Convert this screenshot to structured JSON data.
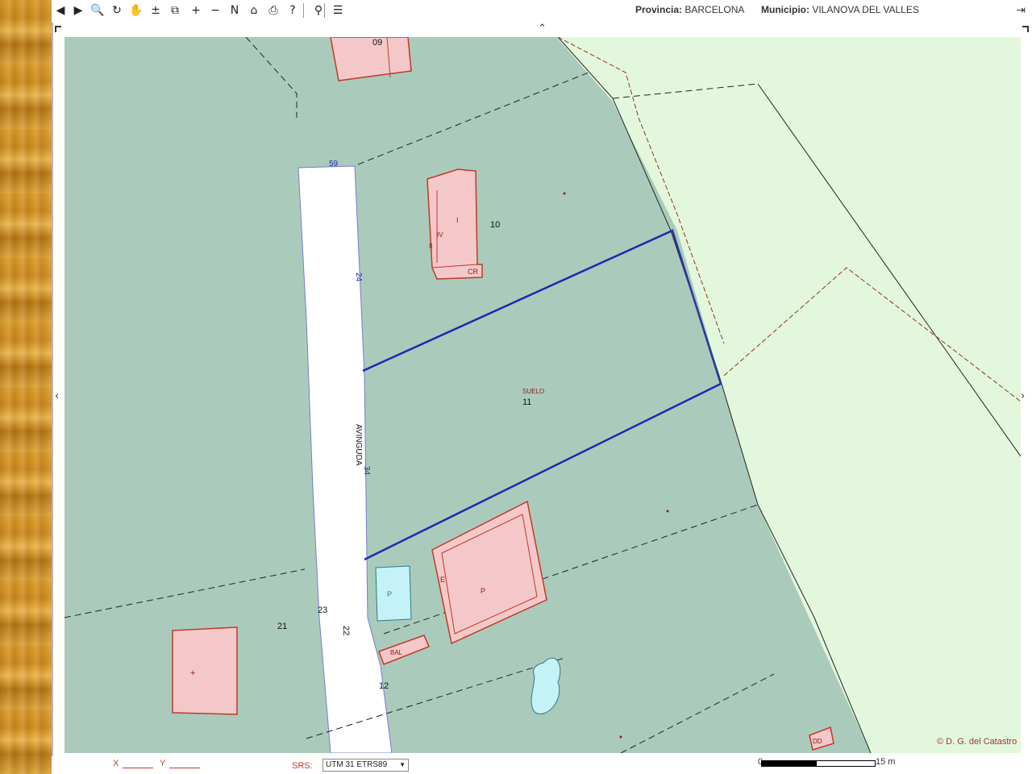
{
  "toolbar": {
    "tools": [
      {
        "name": "back-icon",
        "glyph": "◀"
      },
      {
        "name": "forward-icon",
        "glyph": "▶"
      },
      {
        "name": "zoom-icon",
        "glyph": "🔍"
      },
      {
        "name": "refresh-icon",
        "glyph": "↻"
      },
      {
        "name": "pan-hand-icon",
        "glyph": "✋"
      },
      {
        "name": "measure-icon",
        "glyph": "±"
      },
      {
        "name": "layers-icon",
        "glyph": "⧉"
      },
      {
        "name": "zoom-in-icon",
        "glyph": "+"
      },
      {
        "name": "zoom-out-icon",
        "glyph": "−"
      },
      {
        "name": "north-icon",
        "glyph": "N"
      },
      {
        "name": "home-icon",
        "glyph": "⌂"
      },
      {
        "name": "print-icon",
        "glyph": "⎙"
      },
      {
        "name": "help-icon",
        "glyph": "?"
      },
      {
        "name": "locate-icon",
        "glyph": "⚲"
      },
      {
        "name": "layer-list-icon",
        "glyph": "☰"
      }
    ],
    "provincia_label": "Provincia:",
    "provincia_value": "BARCELONA",
    "municipio_label": "Municipio:",
    "municipio_value": "VILANOVA DEL VALLES",
    "exit_icon": "⇥"
  },
  "map": {
    "labels": {
      "street_name": "AVINGUDA",
      "street_no_top": "59",
      "street_no_left": "24",
      "street_no_mid": "34",
      "parcel_10": "10",
      "parcel_11": "11",
      "parcel_11_tag": "SUELO",
      "parcel_12": "12",
      "parcel_21": "21",
      "parcel_23": "23",
      "parcel_22": "22",
      "building_top_no": "09",
      "building_cr": "CR",
      "building_i": "I",
      "building_iv": "IV",
      "building_ii": "II",
      "building_p": "P",
      "building_plus": "+",
      "building_e": "E",
      "pool_p": "P",
      "shed_label": "BAL",
      "small_tag": "DD"
    },
    "colors": {
      "land_urban": "#aacbbb",
      "land_rural": "#e3f7dd",
      "street": "#ffffff",
      "building": "#f4c8c8",
      "building_border": "#c0392b",
      "pool": "#c4f2f7",
      "selected_parcel": "#1a2ab0",
      "boundary_dash": "#222222",
      "boundary_brown": "#8b3a14"
    }
  },
  "pan": {
    "up": "⌃",
    "down": "⌄",
    "left": "‹",
    "right": "›"
  },
  "bottombar": {
    "x_label": "X",
    "y_label": "Y",
    "srs_label": "SRS:",
    "srs_value": "UTM 31 ETRS89",
    "srs_arrow": "▼",
    "scale_zero": "0",
    "scale_end": "15 m"
  },
  "copyright": "© D. G. del Catastro"
}
